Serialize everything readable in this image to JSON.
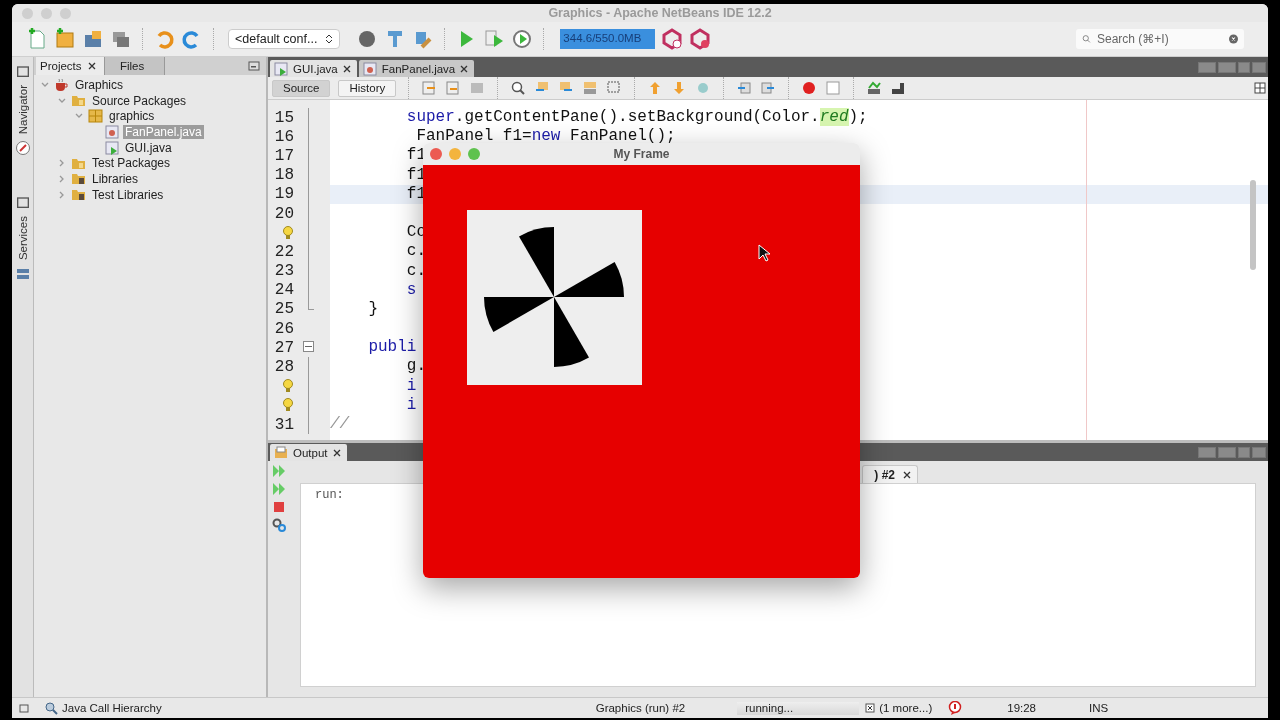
{
  "window": {
    "title": "Graphics - Apache NetBeans IDE 12.2"
  },
  "toolbar": {
    "config": "<default conf...",
    "memory": {
      "reading": "344.6/550.0MB",
      "level": 1
    },
    "search": {
      "placeholder": "Search (⌘+I)"
    }
  },
  "side_tabs": [
    {
      "label": "Navigator"
    },
    {
      "label": "Services"
    }
  ],
  "project_panel": {
    "tabs": [
      {
        "label": "Projects",
        "selected": true
      },
      {
        "label": "Files",
        "selected": false
      }
    ],
    "tree": [
      {
        "label": "Graphics",
        "kind": "project",
        "expanded": true,
        "selected": false,
        "children": [
          {
            "label": "Source Packages",
            "kind": "folder",
            "expanded": true,
            "selected": false,
            "children": [
              {
                "label": "graphics",
                "kind": "package",
                "expanded": true,
                "selected": false,
                "children": [
                  {
                    "label": "FanPanel.java",
                    "kind": "file",
                    "selected": true
                  },
                  {
                    "label": "GUI.java",
                    "kind": "main-file",
                    "selected": false
                  }
                ]
              }
            ]
          },
          {
            "label": "Test Packages",
            "kind": "folder",
            "expanded": false,
            "selected": false
          },
          {
            "label": "Libraries",
            "kind": "library",
            "expanded": false,
            "selected": false
          },
          {
            "label": "Test Libraries",
            "kind": "library",
            "expanded": false,
            "selected": false
          }
        ]
      }
    ]
  },
  "editor": {
    "tabs": [
      {
        "label": "GUI.java",
        "selected": true
      },
      {
        "label": "FanPanel.java",
        "selected": false
      }
    ],
    "modes": [
      {
        "label": "Source",
        "selected": true
      },
      {
        "label": "History",
        "selected": false
      }
    ],
    "lines": [
      {
        "kind": "group",
        "children": [
          {
            "kind": "group",
            "children": [
              {
                "kind": "numbered",
                "number": "15",
                "fold_guide": true,
                "fold_end": false,
                "collapsible": false,
                "current": false,
                "tokens": [
                  {
                    "kind": "keyword",
                    "text": "super"
                  },
                  {
                    "kind": "plain",
                    "text": ".getContentPane().setBackground(Color."
                  },
                  {
                    "kind": "field",
                    "text": "red"
                  },
                  {
                    "kind": "plain",
                    "text": ");"
                  }
                ]
              },
              {
                "kind": "numbered",
                "number": "16",
                "fold_guide": true,
                "fold_end": false,
                "collapsible": false,
                "current": false,
                "tokens": [
                  {
                    "kind": "plain",
                    "text": " FanPanel f1="
                  },
                  {
                    "kind": "keyword",
                    "text": "new"
                  },
                  {
                    "kind": "plain",
                    "text": " FanPanel();"
                  }
                ]
              },
              {
                "kind": "numbered",
                "number": "17",
                "fold_guide": true,
                "fold_end": false,
                "collapsible": false,
                "current": false,
                "tokens": [
                  {
                    "kind": "plain",
                    "text": "f1"
                  }
                ]
              },
              {
                "kind": "numbered",
                "number": "18",
                "fold_guide": true,
                "fold_end": false,
                "collapsible": false,
                "current": false,
                "tokens": [
                  {
                    "kind": "plain",
                    "text": "f1"
                  }
                ]
              },
              {
                "kind": "numbered",
                "number": "19",
                "fold_guide": true,
                "fold_end": false,
                "collapsible": false,
                "current": true,
                "tokens": [
                  {
                    "kind": "plain",
                    "text": "f1"
                  }
                ]
              },
              {
                "kind": "numbered",
                "number": "20",
                "fold_guide": true,
                "fold_end": false,
                "collapsible": false,
                "current": false
              },
              {
                "kind": "hint",
                "fold_guide": true,
                "fold_end": false,
                "collapsible": false,
                "current": false,
                "tokens": [
                  {
                    "kind": "plain",
                    "text": "Co"
                  }
                ]
              },
              {
                "kind": "numbered",
                "number": "22",
                "fold_guide": true,
                "fold_end": false,
                "collapsible": false,
                "current": false,
                "tokens": [
                  {
                    "kind": "plain",
                    "text": "c."
                  }
                ]
              },
              {
                "kind": "numbered",
                "number": "23",
                "fold_guide": true,
                "fold_end": false,
                "collapsible": false,
                "current": false,
                "tokens": [
                  {
                    "kind": "plain",
                    "text": "c."
                  }
                ]
              },
              {
                "kind": "numbered",
                "number": "24",
                "fold_guide": true,
                "fold_end": false,
                "collapsible": false,
                "current": false,
                "tokens": [
                  {
                    "kind": "keyword",
                    "text": "s"
                  }
                ]
              }
            ]
          },
          {
            "kind": "numbered",
            "number": "25",
            "fold_guide": false,
            "fold_end": true,
            "collapsible": false,
            "current": false,
            "tokens": [
              {
                "kind": "plain",
                "text": "}"
              }
            ]
          },
          {
            "kind": "numbered",
            "number": "26",
            "fold_guide": false,
            "fold_end": false,
            "collapsible": false,
            "current": false
          },
          {
            "kind": "numbered",
            "number": "27",
            "fold_guide": false,
            "fold_end": false,
            "collapsible": true,
            "current": false,
            "tokens": [
              {
                "kind": "keyword",
                "text": "publi"
              }
            ],
            "children": [
              {
                "kind": "numbered",
                "number": "28",
                "fold_guide": true,
                "fold_end": false,
                "collapsible": false,
                "current": false,
                "tokens": [
                  {
                    "kind": "plain",
                    "text": "g."
                  }
                ]
              },
              {
                "kind": "hint",
                "fold_guide": true,
                "fold_end": false,
                "collapsible": false,
                "current": false,
                "tokens": [
                  {
                    "kind": "keyword",
                    "text": "i"
                  }
                ]
              },
              {
                "kind": "hint",
                "fold_guide": true,
                "fold_end": false,
                "collapsible": false,
                "current": false,
                "tokens": [
                  {
                    "kind": "keyword",
                    "text": "i"
                  }
                ]
              }
            ]
          }
        ]
      },
      {
        "kind": "numbered",
        "number": "31",
        "fold_guide": true,
        "fold_end": false,
        "collapsible": false,
        "current": false,
        "tokens": [
          {
            "kind": "comment",
            "text": "//"
          }
        ]
      }
    ]
  },
  "output": {
    "tab": "Output",
    "run_tab": ") #2",
    "text": "run:"
  },
  "frame": {
    "title": "My Frame"
  },
  "status_bar": {
    "task": "Java Call Hierarchy",
    "process": "Graphics (run) #2",
    "progress": {
      "text": "running...",
      "level": 1
    },
    "more": "(1 more...)",
    "time": "19:28",
    "mode": "INS"
  }
}
